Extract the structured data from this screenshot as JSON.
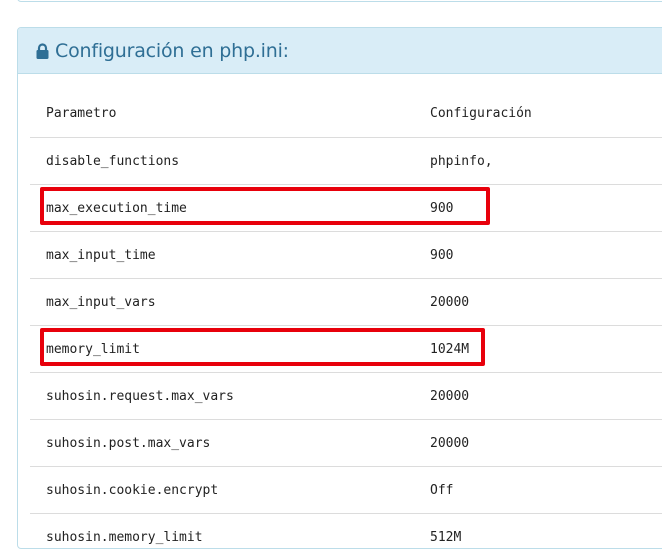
{
  "panel": {
    "title": "Configuración en php.ini"
  },
  "table": {
    "headers": {
      "param": "Parametro",
      "value": "Configuración"
    },
    "rows": [
      {
        "param": "disable_functions",
        "value": "phpinfo,"
      },
      {
        "param": "max_execution_time",
        "value": "900",
        "highlighted": true
      },
      {
        "param": "max_input_time",
        "value": "900"
      },
      {
        "param": "max_input_vars",
        "value": "20000"
      },
      {
        "param": "memory_limit",
        "value": "1024M",
        "highlighted": true
      },
      {
        "param": "suhosin.request.max_vars",
        "value": "20000"
      },
      {
        "param": "suhosin.post.max_vars",
        "value": "20000"
      },
      {
        "param": "suhosin.cookie.encrypt",
        "value": "Off"
      },
      {
        "param": "suhosin.memory_limit",
        "value": "512M"
      }
    ]
  },
  "colors": {
    "heading_bg": "#d9edf7",
    "heading_text": "#2f6f95",
    "highlight": "#e8000b"
  }
}
